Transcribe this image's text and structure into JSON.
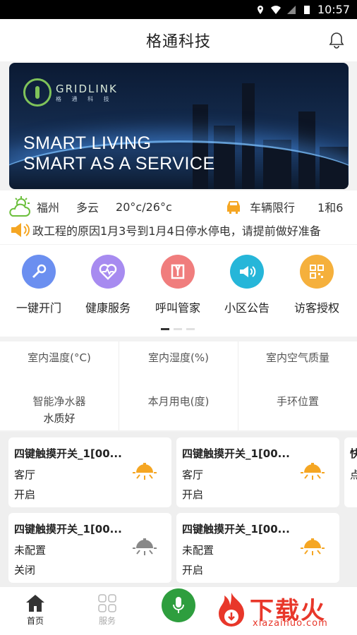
{
  "status_bar": {
    "time": "10:57"
  },
  "header": {
    "title": "格通科技"
  },
  "banner": {
    "brand": "GRIDLINK",
    "brand_sub": "格 通 科 技",
    "slogan_line1": "SMART LIVING",
    "slogan_line2": "SMART AS A SERVICE"
  },
  "weather": {
    "city": "福州",
    "condition": "多云",
    "temperature": "20°c/26°c"
  },
  "traffic": {
    "label": "车辆限行",
    "value": "1和6"
  },
  "notice": {
    "text": "政工程的原因1月3号到1月4日停水停电，请提前做好准备"
  },
  "shortcuts": [
    {
      "label": "一键开门",
      "icon": "key-icon",
      "color": "#6b8ff0"
    },
    {
      "label": "健康服务",
      "icon": "heart-icon",
      "color": "#a78bf0"
    },
    {
      "label": "呼叫管家",
      "icon": "butler-icon",
      "color": "#f07d7d"
    },
    {
      "label": "小区公告",
      "icon": "megaphone-icon",
      "color": "#26b6d9"
    },
    {
      "label": "访客授权",
      "icon": "qrcode-icon",
      "color": "#f5b03c"
    }
  ],
  "env_grid": {
    "row1": [
      "室内温度(°C)",
      "室内湿度(%)",
      "室内空气质量"
    ],
    "row2": [
      "智能净水器",
      "本月用电(度)",
      "手环位置"
    ],
    "water_quality": "水质好"
  },
  "devices": [
    {
      "name": "四键触摸开关_1[00...",
      "room": "客厅",
      "state": "开启",
      "on": true
    },
    {
      "name": "四键触摸开关_1[00...",
      "room": "客厅",
      "state": "开启",
      "on": true
    },
    {
      "name": "四键触摸开关_1[00...",
      "room": "未配置",
      "state": "关闭",
      "on": false
    },
    {
      "name": "四键触摸开关_1[00...",
      "room": "未配置",
      "state": "开启",
      "on": true
    }
  ],
  "partial_card": {
    "t1": "快",
    "t2": "点"
  },
  "tabbar": {
    "home": "首页",
    "services": "服务"
  },
  "watermark": {
    "big": "下载火",
    "small": "xiazaihuo.com"
  },
  "colors": {
    "accent": "#2e9e3e",
    "lamp_on": "#f5a623",
    "lamp_off": "#888888",
    "watermark": "#e8372a"
  }
}
